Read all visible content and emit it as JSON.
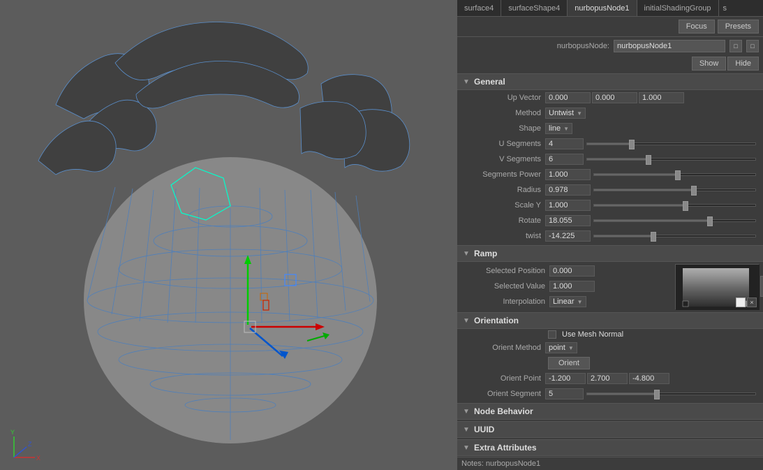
{
  "tabs": [
    {
      "label": "surface4",
      "active": false
    },
    {
      "label": "surfaceShape4",
      "active": false
    },
    {
      "label": "nurbopusNode1",
      "active": true
    },
    {
      "label": "initialShadingGroup",
      "active": false
    },
    {
      "label": "s",
      "active": false
    }
  ],
  "top_controls": {
    "node_label": "nurbopusNode:",
    "node_value": "nurbopusNode1",
    "focus_label": "Focus",
    "presets_label": "Presets",
    "show_label": "Show",
    "hide_label": "Hide"
  },
  "general": {
    "title": "General",
    "up_vector_label": "Up Vector",
    "up_x": "0.000",
    "up_y": "0.000",
    "up_z": "1.000",
    "method_label": "Method",
    "method_value": "Untwist",
    "shape_label": "Shape",
    "shape_value": "line",
    "u_segments_label": "U Segments",
    "u_segments_value": "4",
    "v_segments_label": "V Segments",
    "v_segments_value": "6",
    "segments_power_label": "Segments Power",
    "segments_power_value": "1.000",
    "radius_label": "Radius",
    "radius_value": "0.978",
    "scale_y_label": "Scale Y",
    "scale_y_value": "1.000",
    "rotate_label": "Rotate",
    "rotate_value": "18.055",
    "twist_label": "twist",
    "twist_value": "-14.225"
  },
  "ramp": {
    "title": "Ramp",
    "selected_position_label": "Selected Position",
    "selected_position_value": "0.000",
    "selected_value_label": "Selected Value",
    "selected_value_value": "1.000",
    "interpolation_label": "Interpolation",
    "interpolation_value": "Linear",
    "expand_btn": ">"
  },
  "orientation": {
    "title": "Orientation",
    "use_mesh_normal_label": "Use Mesh Normal",
    "orient_method_label": "Orient Method",
    "orient_method_value": "point",
    "orient_btn_label": "Orient",
    "orient_point_label": "Orient Point",
    "orient_point_x": "-1.200",
    "orient_point_y": "2.700",
    "orient_point_z": "-4.800",
    "orient_segment_label": "Orient Segment",
    "orient_segment_value": "5"
  },
  "node_behavior": {
    "title": "Node Behavior"
  },
  "uuid": {
    "title": "UUID"
  },
  "extra_attributes": {
    "title": "Extra Attributes"
  },
  "notes": {
    "label": "Notes:",
    "value": "nurbopusNode1"
  },
  "axis": {
    "x_label": "X",
    "y_label": "Y",
    "z_label": "Z"
  }
}
